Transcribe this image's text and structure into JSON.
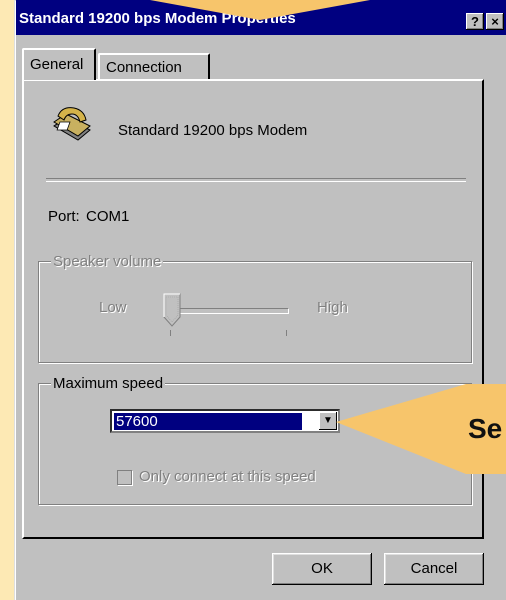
{
  "window": {
    "title": "Standard 19200 bps Modem Properties",
    "help_button": "?",
    "close_button": "×"
  },
  "tabs": [
    {
      "label": "General",
      "active": true
    },
    {
      "label": "Connection",
      "active": false
    }
  ],
  "modem": {
    "icon": "telephone-modem-icon",
    "name": "Standard 19200 bps Modem"
  },
  "port": {
    "label": "Port:",
    "value": "COM1"
  },
  "speaker_volume": {
    "group_label": "Speaker volume",
    "low_label": "Low",
    "high_label": "High",
    "level": 0,
    "enabled": false
  },
  "max_speed": {
    "group_label": "Maximum speed",
    "selected_value": "57600",
    "checkbox_label": "Only connect at this speed",
    "checkbox_checked": false,
    "checkbox_enabled": false
  },
  "buttons": {
    "ok": "OK",
    "cancel": "Cancel"
  },
  "callout": {
    "text": "Se"
  },
  "colors": {
    "titlebar": "#000080",
    "face": "#c0c0c0",
    "callout": "#f7c56b",
    "background": "#fde9b4"
  }
}
